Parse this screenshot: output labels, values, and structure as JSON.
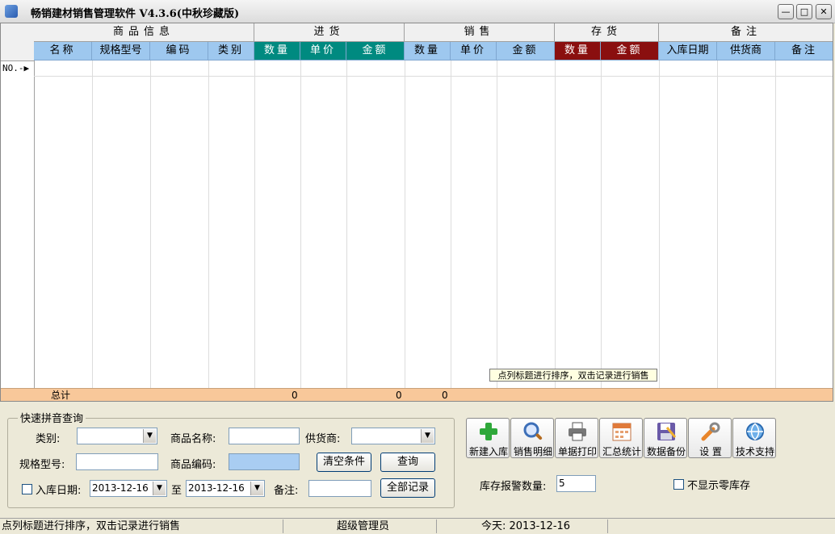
{
  "window": {
    "title": "畅销建材销售管理软件 V4.3.6(中秋珍藏版)",
    "minimize_glyph": "—",
    "maximize_glyph": "□",
    "close_glyph": "✕",
    "app_icon": "app-shield-icon"
  },
  "grid": {
    "groups": [
      "商品信息",
      "进货",
      "销售",
      "存货",
      "备注"
    ],
    "columns": [
      "名称",
      "规格型号",
      "编码",
      "类别",
      "数量",
      "单价",
      "金额",
      "数量",
      "单价",
      "金额",
      "数量",
      "金额",
      "入库日期",
      "供货商",
      "备注"
    ],
    "row_marker": "NO.-▶",
    "totals": {
      "label": "总计",
      "purchase_amount": "0",
      "sales_qty": "0",
      "sales_amount": "0"
    },
    "colors": {
      "header_blue": "#9ec8ef",
      "purchase_accent": "#008a80",
      "stock_accent": "#8a0f0f",
      "totals_bg": "#f8c89a"
    }
  },
  "tooltip": "点列标题进行排序，双击记录进行销售",
  "query": {
    "title": "快速拼音查询",
    "category_label": "类别:",
    "name_label": "商品名称:",
    "supplier_label": "供货商:",
    "spec_label": "规格型号:",
    "code_label": "商品编码:",
    "clear_btn": "清空条件",
    "search_btn": "查询",
    "date_label": "入库日期:",
    "date_from": "2013-12-16",
    "date_to_label": "至",
    "date_to": "2013-12-16",
    "note_label": "备注:",
    "all_btn": "全部记录"
  },
  "toolbar": [
    {
      "label": "新建入库",
      "icon": "plus-icon"
    },
    {
      "label": "销售明细",
      "icon": "magnifier-icon"
    },
    {
      "label": "单据打印",
      "icon": "printer-icon"
    },
    {
      "label": "汇总统计",
      "icon": "calendar-icon"
    },
    {
      "label": "数据备份",
      "icon": "floppy-disk-icon"
    },
    {
      "label": "设 置",
      "icon": "wrench-icon"
    },
    {
      "label": "技术支持",
      "icon": "globe-icon"
    }
  ],
  "stock_alert": {
    "label": "库存报警数量:",
    "value": "5"
  },
  "hide_zero_label": "不显示零库存",
  "status": {
    "hint": "点列标题进行排序，双击记录进行销售",
    "user": "超级管理员",
    "today": "今天:  2013-12-16"
  }
}
